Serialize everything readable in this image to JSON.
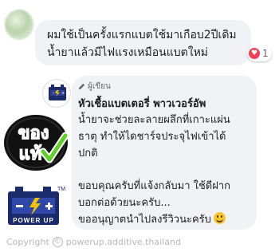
{
  "first_comment": {
    "line1": "ผมใช้เป็นครั้งแรกแบตใช้มาเกือบ2ปีเดิม",
    "line2": "น้ำยาแล้วมีไฟแรงเหมือนแบตใหม่",
    "reaction_count": "1",
    "reaction_icon": "heart-reaction-icon",
    "reaction_color": "#f33e58"
  },
  "reply": {
    "author_badge": "ผู้เขียน",
    "page_name": "หัวเชื้อแบตเตอรี่ พาวเวอร์อัพ",
    "paragraph1": [
      "น้ำยาจะช่วยละลายผลึกที่เกาะแผ่น",
      "ธาตุ ทำให้ไดชาร์จประจุไฟเข้าได้",
      "ปกติ"
    ],
    "paragraph2": [
      "ขอบคุณครับที่แจ้งกลับมา ใช้ดีฝาก",
      "บอกต่อด้วยนะครับ...",
      "ขออนุญาตนำไปลงรีวิวนะครับ"
    ]
  },
  "stamp": {
    "text": "ของแท้"
  },
  "logo": {
    "label": "POWER UP",
    "tm": "TM"
  },
  "watermark": {
    "symbol": "©",
    "text": "powerup.additive.thailand",
    "prefix": "Copyright"
  }
}
